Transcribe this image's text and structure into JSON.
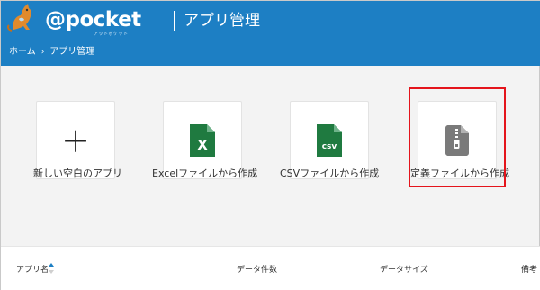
{
  "header": {
    "logo_text": "@pocket",
    "logo_sub": "アットポケット",
    "app_title": "アプリ管理",
    "breadcrumb": {
      "home": "ホーム",
      "separator": "›",
      "current": "アプリ管理"
    },
    "colors": {
      "bar": "#1d7fc4"
    }
  },
  "cards": [
    {
      "label": "新しい空白のアプリ",
      "icon": "plus-icon"
    },
    {
      "label": "Excelファイルから作成",
      "icon": "excel-file-icon",
      "icon_text": "X",
      "color": "#1f7a40"
    },
    {
      "label": "CSVファイルから作成",
      "icon": "csv-file-icon",
      "icon_text": "csv",
      "color": "#1f7a40"
    },
    {
      "label": "定義ファイルから作成",
      "icon": "zip-file-icon",
      "color": "#7a7a7a",
      "highlighted": true
    }
  ],
  "table": {
    "columns": [
      "アプリ名",
      "データ件数",
      "データサイズ",
      "備考"
    ]
  }
}
